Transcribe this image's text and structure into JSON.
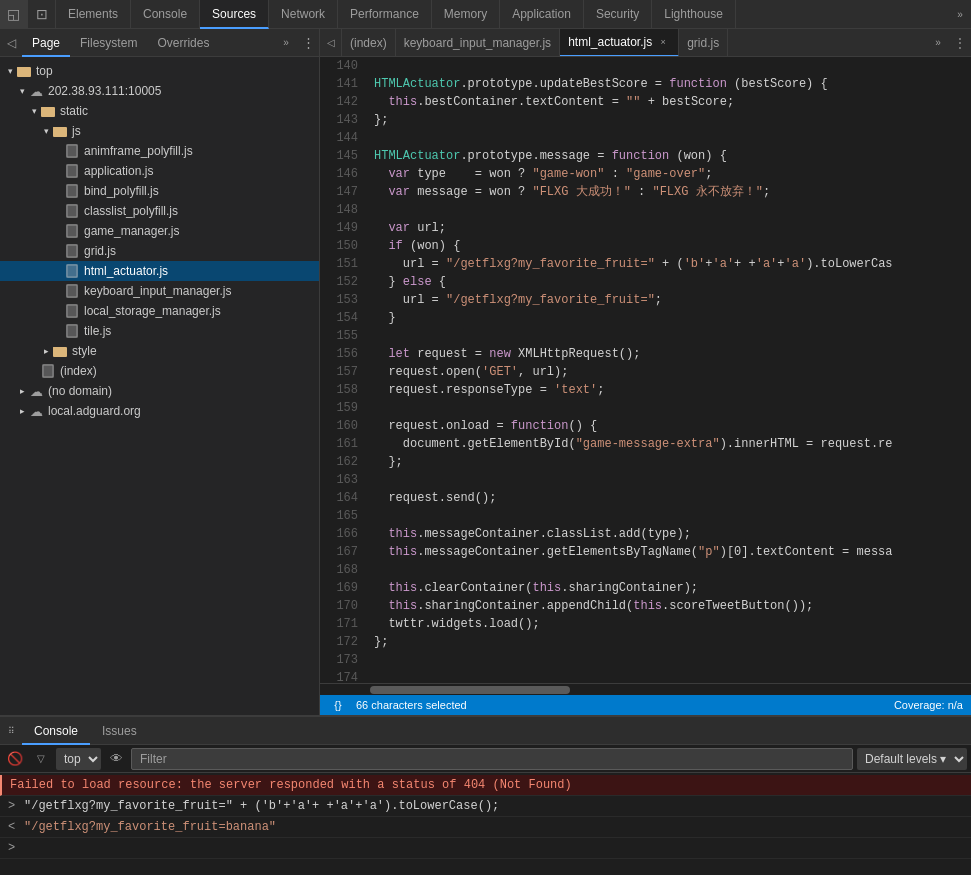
{
  "toolbar": {
    "icons": [
      "◱",
      "⊡"
    ],
    "tabs": [
      {
        "label": "Elements",
        "active": false
      },
      {
        "label": "Console",
        "active": false
      },
      {
        "label": "Sources",
        "active": true
      },
      {
        "label": "Network",
        "active": false
      },
      {
        "label": "Performance",
        "active": false
      },
      {
        "label": "Memory",
        "active": false
      },
      {
        "label": "Application",
        "active": false
      },
      {
        "label": "Security",
        "active": false
      },
      {
        "label": "Lighthouse",
        "active": false
      }
    ],
    "more": "»"
  },
  "left_panel": {
    "sub_tabs": [
      {
        "label": "Page",
        "active": true
      },
      {
        "label": "Filesystem",
        "active": false
      },
      {
        "label": "Overrides",
        "active": false
      }
    ],
    "more": "»",
    "tree": [
      {
        "level": 0,
        "arrow": "▾",
        "icon": "folder",
        "label": "top"
      },
      {
        "level": 1,
        "arrow": "▾",
        "icon": "cloud",
        "label": "202.38.93.111:10005"
      },
      {
        "level": 2,
        "arrow": "▾",
        "icon": "folder",
        "label": "static"
      },
      {
        "level": 3,
        "arrow": "▾",
        "icon": "folder",
        "label": "js"
      },
      {
        "level": 4,
        "arrow": "",
        "icon": "file",
        "label": "animframe_polyfill.js"
      },
      {
        "level": 4,
        "arrow": "",
        "icon": "file",
        "label": "application.js"
      },
      {
        "level": 4,
        "arrow": "",
        "icon": "file",
        "label": "bind_polyfill.js"
      },
      {
        "level": 4,
        "arrow": "",
        "icon": "file",
        "label": "classlist_polyfill.js"
      },
      {
        "level": 4,
        "arrow": "",
        "icon": "file",
        "label": "game_manager.js"
      },
      {
        "level": 4,
        "arrow": "",
        "icon": "file",
        "label": "grid.js"
      },
      {
        "level": 4,
        "arrow": "",
        "icon": "file",
        "label": "html_actuator.js",
        "selected": true
      },
      {
        "level": 4,
        "arrow": "",
        "icon": "file",
        "label": "keyboard_input_manager.js"
      },
      {
        "level": 4,
        "arrow": "",
        "icon": "file",
        "label": "local_storage_manager.js"
      },
      {
        "level": 4,
        "arrow": "",
        "icon": "file",
        "label": "tile.js"
      },
      {
        "level": 3,
        "arrow": "▸",
        "icon": "folder",
        "label": "style"
      },
      {
        "level": 2,
        "arrow": "",
        "icon": "file",
        "label": "(index)"
      },
      {
        "level": 1,
        "arrow": "▸",
        "icon": "cloud",
        "label": "(no domain)"
      },
      {
        "level": 1,
        "arrow": "▸",
        "icon": "cloud",
        "label": "local.adguard.org"
      }
    ]
  },
  "editor": {
    "tabs": [
      {
        "label": "(index)",
        "closeable": false,
        "active": false
      },
      {
        "label": "keyboard_input_manager.js",
        "closeable": false,
        "active": false
      },
      {
        "label": "html_actuator.js",
        "closeable": true,
        "active": true
      },
      {
        "label": "grid.js",
        "closeable": false,
        "active": false
      }
    ],
    "more": "»",
    "status": "66 characters selected",
    "coverage": "Coverage: n/a"
  },
  "console": {
    "tabs": [
      {
        "label": "Console",
        "active": true
      },
      {
        "label": "Issues",
        "active": false
      }
    ],
    "toolbar": {
      "clear_label": "🚫",
      "filter_placeholder": "Filter",
      "levels_label": "Default levels ▾",
      "context_label": "top"
    },
    "lines": [
      {
        "type": "error",
        "text": "Failed to load resource: the server responded with a status of 404 (Not Found)"
      },
      {
        "type": "prompt",
        "arrow": ">",
        "text": "\"/getflxg?my_favorite_fruit=\" + ('b'+'a'+ +'a'+'a').toLowerCase();"
      },
      {
        "type": "result",
        "arrow": "<",
        "text": "\"/getflxg?my_favorite_fruit=banana\""
      },
      {
        "type": "prompt",
        "arrow": ">",
        "text": ""
      }
    ]
  }
}
